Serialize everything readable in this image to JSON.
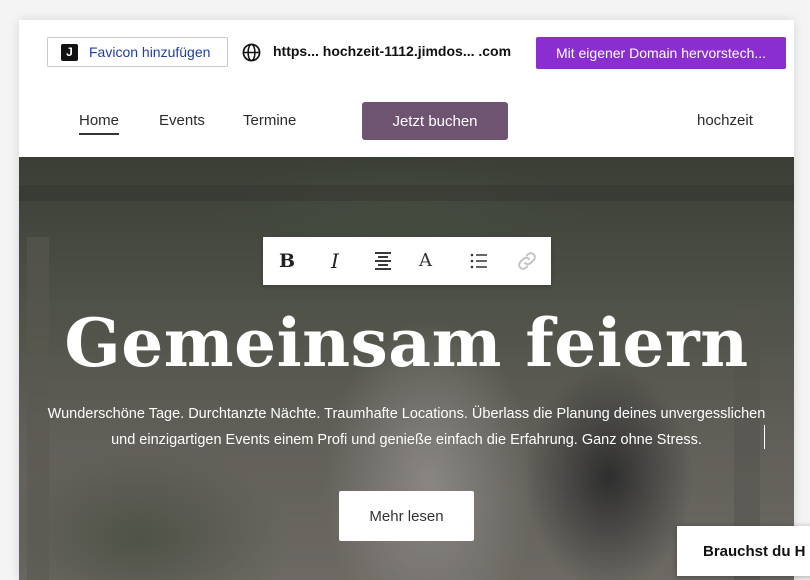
{
  "topbar": {
    "favicon_logo": "J",
    "favicon_label": "Favicon hinzufügen",
    "url": "https... hochzeit-1112.jimdos... .com",
    "domain_button": "Mit eigener Domain hervorstech..."
  },
  "nav": {
    "items": [
      "Home",
      "Events",
      "Termine"
    ],
    "book_button": "Jetzt buchen",
    "site_name": "hochzeit"
  },
  "toolbar": {
    "bold_glyph": "B",
    "italic_glyph": "I",
    "font_glyph": "A",
    "icons": [
      "bold-icon",
      "italic-icon",
      "align-center-icon",
      "font-style-icon",
      "list-icon",
      "link-icon"
    ]
  },
  "hero": {
    "title": "Gemeinsam feiern",
    "text": "Wunderschöne Tage. Durchtanzte Nächte. Traumhafte Locations. Überlass die Planung deines unvergesslichen und einzigartigen Events einem Profi und genieße einfach die Erfahrung. Ganz ohne Stress.",
    "button": "Mehr lesen"
  },
  "help": {
    "label": "Brauchst du H"
  },
  "colors": {
    "domain_button": "#8a2ed1",
    "book_button": "#6e5470",
    "favicon_text": "#1e3ea8"
  }
}
